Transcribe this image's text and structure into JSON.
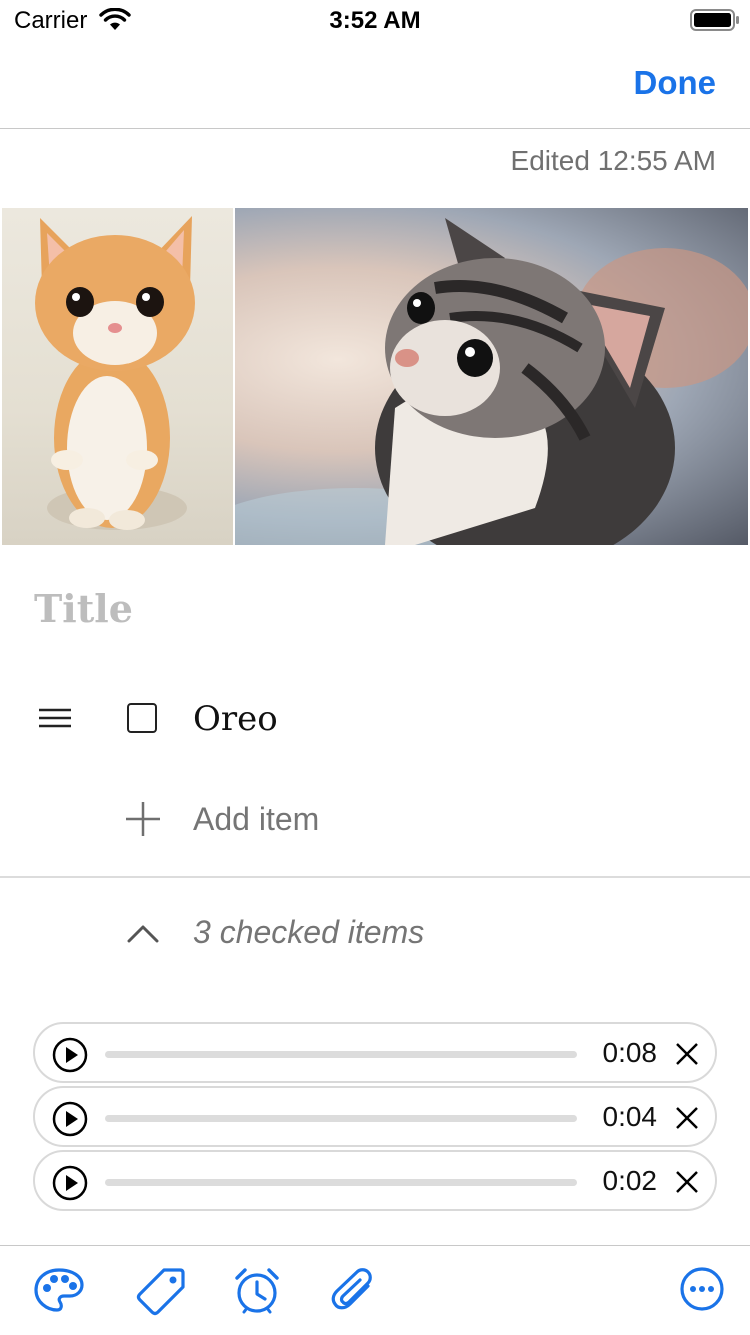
{
  "status_bar": {
    "carrier": "Carrier",
    "time": "3:52 AM"
  },
  "nav": {
    "done_label": "Done"
  },
  "note": {
    "edited_text": "Edited 12:55 AM",
    "title_placeholder": "Title",
    "items": [
      {
        "text": "Oreo",
        "checked": false
      }
    ],
    "add_item_label": "Add item",
    "checked_items_label": "3 checked items"
  },
  "images": [
    {
      "description": "orange kitten standing",
      "icon": "photo"
    },
    {
      "description": "tabby kitten looking up",
      "icon": "photo"
    }
  ],
  "audio_recordings": [
    {
      "duration": "0:08"
    },
    {
      "duration": "0:04"
    },
    {
      "duration": "0:02"
    }
  ],
  "toolbar": {
    "icons": [
      "palette-icon",
      "label-icon",
      "reminder-icon",
      "attachment-icon",
      "more-icon"
    ]
  },
  "colors": {
    "accent": "#1a73e8",
    "placeholder": "#bdbdbd",
    "secondary_text": "#757575"
  }
}
